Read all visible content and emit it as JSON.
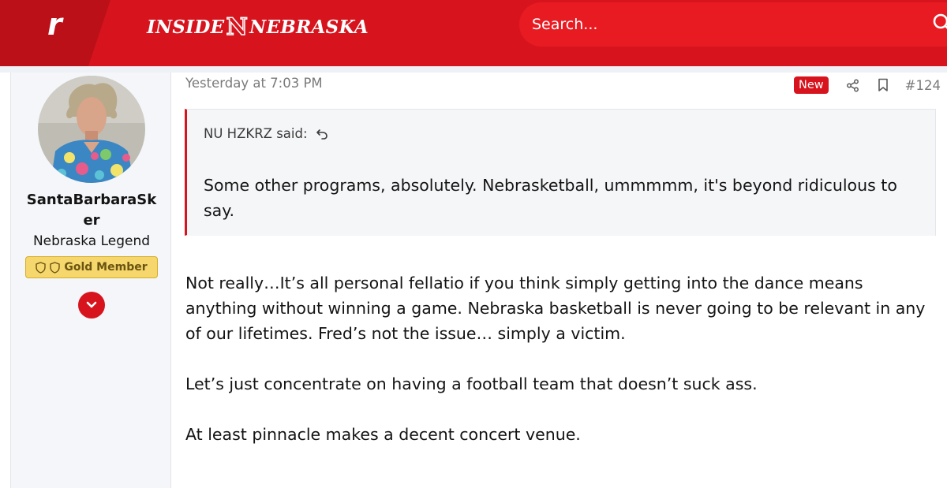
{
  "header": {
    "site_title_left": "INSIDE",
    "site_title_mark": "N",
    "site_title_right": "NEBRASKA",
    "logo_letter": "r",
    "logo_icon": "rivals-r-icon",
    "search_placeholder": "Search...",
    "search_icon": "search-icon",
    "brand_color": "#d7141e"
  },
  "user": {
    "username": "SantaBarbaraSker",
    "title": "Nebraska Legend",
    "badge_label": "Gold Member",
    "badge_icons": [
      "shield-icon",
      "shield-icon"
    ],
    "expand_icon": "chevron-down-icon"
  },
  "post": {
    "timestamp": "Yesterday at 7:03 PM",
    "new_label": "New",
    "share_icon": "share-icon",
    "bookmark_icon": "bookmark-icon",
    "number": "#124",
    "quote": {
      "author": "NU HZKRZ said:",
      "jump_icon": "reply-arrow-icon",
      "text": "Some other programs, absolutely. Nebrasketball, ummmmm, it's beyond ridiculous to say."
    },
    "paragraphs": [
      "Not really…It’s all personal fellatio if you think simply getting into the dance means anything without winning a game. Nebraska basketball is never going to be relevant in any of our lifetimes. Fred’s not the issue… simply a victim.",
      "Let’s just concentrate on having a football team that doesn’t suck ass.",
      "At least pinnacle makes a decent concert venue."
    ]
  }
}
